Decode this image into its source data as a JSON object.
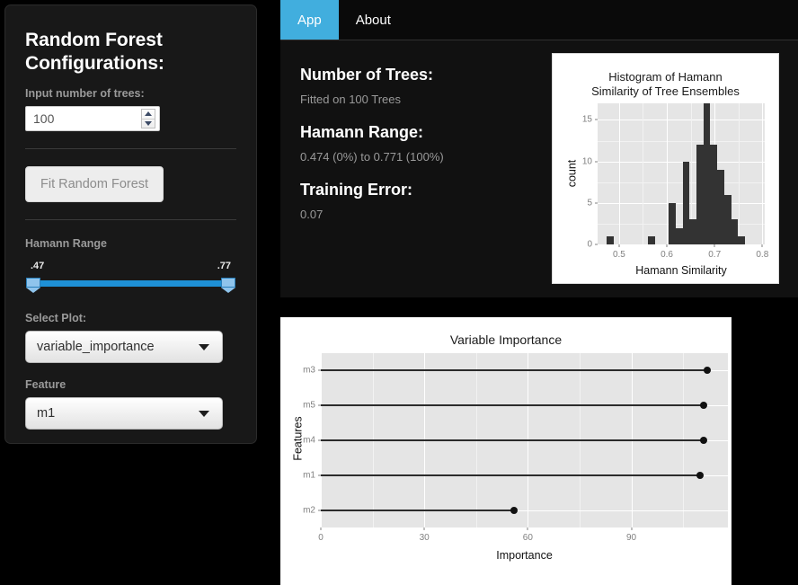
{
  "sidebar": {
    "title": "Random Forest Configurations:",
    "trees_label": "Input number of trees:",
    "trees_value": "100",
    "fit_button": "Fit Random Forest",
    "hamann_range_label": "Hamann Range",
    "slider_min_cap": ".47",
    "slider_max_cap": ".77",
    "select_plot_label": "Select Plot:",
    "select_plot_value": "variable_importance",
    "feature_label": "Feature",
    "feature_value": "m1"
  },
  "tabs": [
    {
      "label": "App",
      "active": true
    },
    {
      "label": "About",
      "active": false
    }
  ],
  "stats": [
    {
      "heading": "Number of Trees:",
      "value": "Fitted on 100 Trees"
    },
    {
      "heading": "Hamann Range:",
      "value": "0.474 (0%) to 0.771 (100%)"
    },
    {
      "heading": "Training Error:",
      "value": "0.07"
    }
  ],
  "colors": {
    "accent_blue": "#41aede",
    "slider_blue": "#1e90d6",
    "panel_grey": "#e5e5e5",
    "bar_dark": "#333333",
    "page_black": "#000000",
    "sidebar_bg": "#181818"
  },
  "chart_data": [
    {
      "type": "bar",
      "title": "Histogram of Hamann Similarity of Tree Ensembles",
      "title_line1": "Histogram of Hamann",
      "title_line2": "Similarity of Tree Ensembles",
      "xlabel": "Hamann Similarity",
      "ylabel": "count",
      "xlim": [
        0.455,
        0.805
      ],
      "ylim": [
        0,
        17
      ],
      "xticks": [
        0.5,
        0.6,
        0.7,
        0.8
      ],
      "xtick_labels": [
        "0.5",
        "0.6",
        "0.7",
        "0.8"
      ],
      "yticks": [
        0,
        5,
        10,
        15
      ],
      "ytick_labels": [
        "0",
        "5",
        "10",
        "15"
      ],
      "grid": true,
      "bin_width": 0.0145,
      "bin_starts": [
        0.4735,
        0.5605,
        0.604,
        0.6185,
        0.633,
        0.6475,
        0.662,
        0.6765,
        0.691,
        0.7055,
        0.72,
        0.7345,
        0.749,
        0.7635
      ],
      "values": [
        1,
        1,
        5,
        2,
        10,
        3,
        12,
        17,
        12,
        9,
        6,
        3,
        1,
        0
      ],
      "bin_labels": [
        "0.474",
        "0.561",
        "0.604",
        "0.619",
        "0.633",
        "0.648",
        "0.662",
        "0.677",
        "0.691",
        "0.706",
        "0.720",
        "0.735",
        "0.749",
        "0.764"
      ]
    },
    {
      "type": "bar",
      "orientation": "horizontal",
      "style": "lollipop",
      "title": "Variable Importance",
      "xlabel": "Importance",
      "ylabel": "Features",
      "categories": [
        "m2",
        "m1",
        "m4",
        "m5",
        "m3"
      ],
      "values": [
        56,
        110,
        111,
        111,
        112
      ],
      "xlim": [
        0,
        118
      ],
      "xticks": [
        0,
        30,
        60,
        90
      ],
      "xtick_labels": [
        "0",
        "30",
        "60",
        "90"
      ],
      "grid": true
    }
  ]
}
